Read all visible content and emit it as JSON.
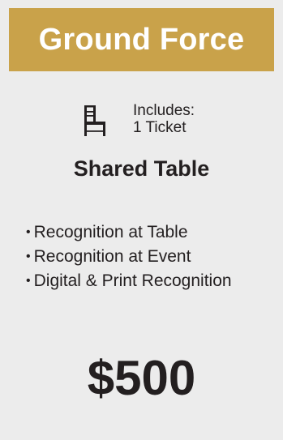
{
  "header": {
    "title": "Ground Force"
  },
  "includes": {
    "icon": "chair-icon",
    "label": "Includes:",
    "tickets": "1 Ticket"
  },
  "table_type": "Shared Table",
  "benefits": [
    "Recognition at Table",
    "Recognition at Event",
    "Digital & Print Recognition"
  ],
  "price": "$500",
  "colors": {
    "header_bg": "#c9a24a",
    "card_bg": "#ececec",
    "text": "#231f20",
    "header_text": "#ffffff"
  }
}
